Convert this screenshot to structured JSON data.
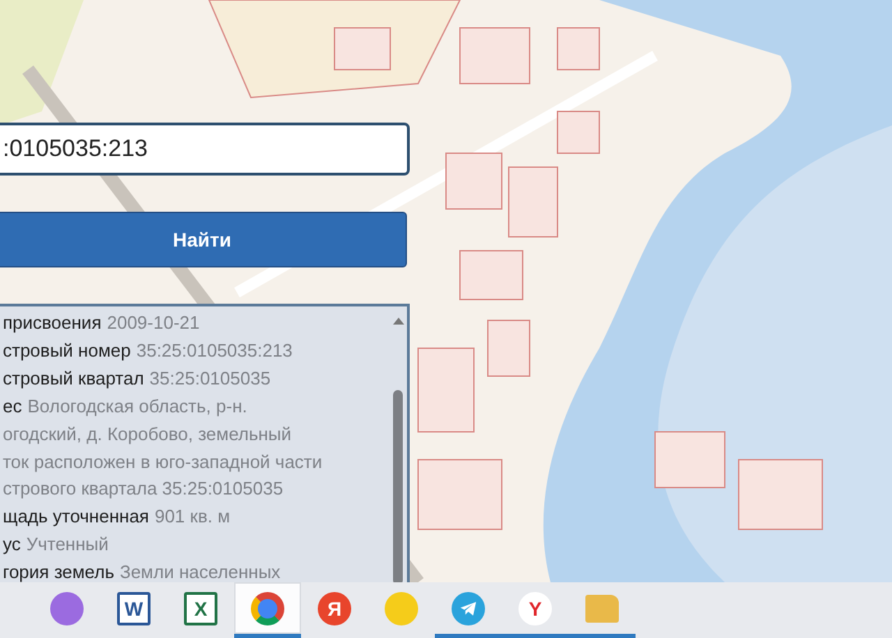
{
  "search": {
    "value": ":0105035:213"
  },
  "find_button": {
    "label": "Найти"
  },
  "info_panel": {
    "lines": [
      {
        "label": "присвоения",
        "value": "2009-10-21"
      },
      {
        "label": "стровый номер",
        "value": "35:25:0105035:213"
      },
      {
        "label": "стровый квартал",
        "value": "35:25:0105035"
      },
      {
        "label": "ес",
        "value": "Вологодская область, р-н."
      },
      {
        "value": "огодский, д. Коробово, земельный"
      },
      {
        "value": "ток расположен в юго-западной части"
      },
      {
        "value": "стрового квартала 35:25:0105035"
      },
      {
        "label": "щадь уточненная",
        "value": "901 кв. м"
      },
      {
        "label": "ус",
        "value": "Учтенный"
      },
      {
        "label": "гория земель",
        "value": "Земли населенных"
      }
    ]
  },
  "taskbar": {
    "apps": [
      {
        "kind": "circle",
        "color": "#9b6be0",
        "running": false,
        "selected": false
      },
      {
        "kind": "doc",
        "color": "#2b5797",
        "glyph": "W",
        "running": false,
        "selected": false
      },
      {
        "kind": "doc",
        "color": "#217346",
        "glyph": "X",
        "running": false,
        "selected": false
      },
      {
        "kind": "chrome",
        "color": "#4285f4",
        "running": true,
        "selected": true
      },
      {
        "kind": "circle",
        "color": "#e8452c",
        "glyph": "Я",
        "running": false,
        "selected": false
      },
      {
        "kind": "circle",
        "color": "#f5cc1a",
        "running": false,
        "selected": false
      },
      {
        "kind": "plane",
        "color": "#2aa3dc",
        "running": true,
        "selected": false
      },
      {
        "kind": "circle",
        "color": "#ffffff",
        "glyph": "Y",
        "running": true,
        "selected": false
      },
      {
        "kind": "folder",
        "color": "#e9b949",
        "running": true,
        "selected": false
      }
    ]
  }
}
